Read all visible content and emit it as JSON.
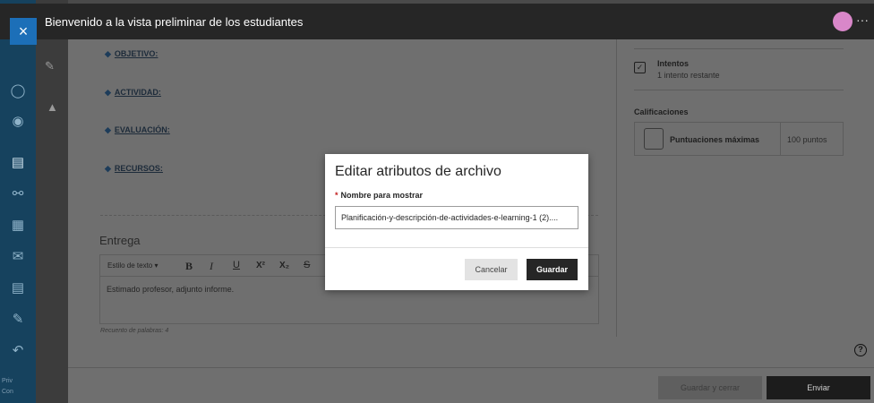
{
  "header": {
    "title": "Bienvenido a la vista preliminar de los estudiantes",
    "close_icon": "×",
    "more_icon": "···"
  },
  "sidebar": {
    "icons": [
      "user-icon",
      "globe-icon",
      "courses-icon",
      "groups-icon",
      "calendar-icon",
      "mail-icon",
      "grades-icon",
      "edit-icon",
      "logout-icon"
    ],
    "legal_1": "Priv",
    "legal_2": "Con"
  },
  "content": {
    "sections": [
      {
        "label": "OBJETIVO:"
      },
      {
        "label": "ACTIVIDAD:"
      },
      {
        "label": "EVALUACIÓN:"
      },
      {
        "label": "RECURSOS:"
      }
    ],
    "submission_title": "Entrega",
    "toolbar": {
      "style_label": "Estilo de texto",
      "bold": "B",
      "italic": "I",
      "underline": "U",
      "superscript": "X²",
      "subscript": "X₂",
      "strike": "S"
    },
    "editor_text": "Estimado profesor, adjunto informe.",
    "word_count": "Recuento de palabras: 4"
  },
  "right_panel": {
    "attempts_title": "Intentos",
    "attempts_sub": "1 intento restante",
    "grades_title": "Calificaciones",
    "max_score_label": "Puntuaciones máximas",
    "max_score_value": "100 puntos",
    "help_icon": "?"
  },
  "footer": {
    "save_close": "Guardar y cerrar",
    "submit": "Enviar"
  },
  "modal": {
    "title": "Editar atributos de archivo",
    "field_label": "Nombre para mostrar",
    "required_mark": "*",
    "field_value": "Planificación-y-descripción-de-actividades-e-learning-1 (2)....",
    "cancel": "Cancelar",
    "save": "Guardar"
  },
  "colors": {
    "accent": "#1c6fb8",
    "nav": "#16425e",
    "header": "#262626"
  }
}
